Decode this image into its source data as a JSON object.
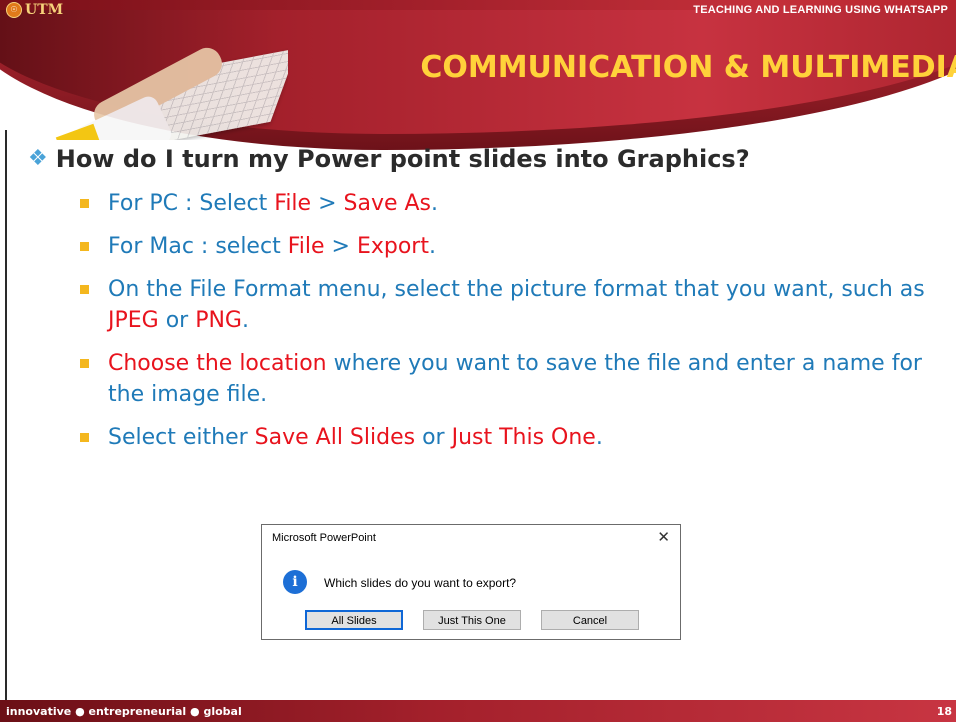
{
  "header": {
    "logo_text": "UTM",
    "top_title": "TEACHING AND LEARNING USING WHATSAPP",
    "main_title": "COMMUNICATION & MULTIMEDIA"
  },
  "question": "How do I turn my Power point slides into Graphics?",
  "steps": [
    {
      "parts": [
        "For PC : Select ",
        "File",
        " > ",
        "Save As",
        "."
      ]
    },
    {
      "parts": [
        "For Mac : select ",
        "File",
        " > ",
        "Export",
        "."
      ]
    },
    {
      "parts": [
        "On the File Format menu, select the picture format that you want, such as ",
        "JPEG",
        " or ",
        "PNG",
        "."
      ]
    },
    {
      "parts": [
        "Choose the location",
        " where you want to save the file and enter a name for the image file."
      ]
    },
    {
      "parts": [
        "Select either ",
        "Save All Slides",
        " or ",
        "Just This One",
        "."
      ]
    }
  ],
  "dialog": {
    "title": "Microsoft PowerPoint",
    "close": "✕",
    "info_glyph": "i",
    "message": "Which slides do you want to export?",
    "buttons": {
      "all": "All Slides",
      "one": "Just This One",
      "cancel": "Cancel"
    }
  },
  "footer": {
    "tagline": "innovative ● entrepreneurial ● global",
    "page_number": "18"
  },
  "colors": {
    "accent_blue": "#1f7ab8",
    "highlight_red": "#e8131d",
    "title_yellow": "#ffd23a",
    "brand_red": "#a3202b"
  }
}
